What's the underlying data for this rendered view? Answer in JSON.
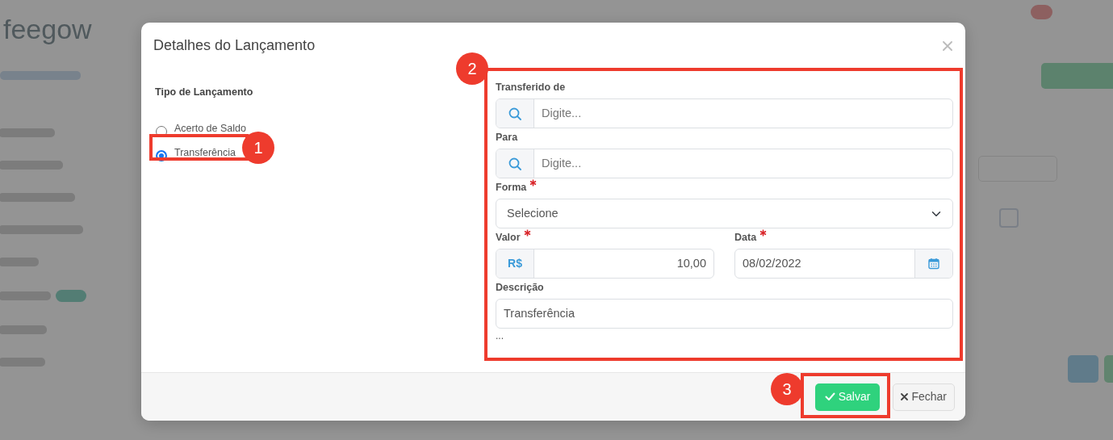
{
  "background": {
    "logo": "feegow",
    "checkbox": {
      "checked": false
    }
  },
  "modal": {
    "title": "Detalhes do Lançamento",
    "type_label": "Tipo de Lançamento",
    "types": [
      {
        "label": "Acerto de Saldo",
        "selected": false
      },
      {
        "label": "Transferência",
        "selected": true
      }
    ],
    "rows": [
      {
        "fields": [
          {
            "kind": "search",
            "label": "Transferido de",
            "required": false,
            "placeholder": "Digite..."
          }
        ]
      },
      {
        "fields": [
          {
            "kind": "search",
            "label": "Para",
            "required": false,
            "placeholder": "Digite..."
          }
        ]
      },
      {
        "fields": [
          {
            "kind": "select",
            "label": "Forma",
            "required": true,
            "value": "Selecione"
          }
        ]
      },
      {
        "fields": [
          {
            "kind": "currency",
            "label": "Valor",
            "required": true,
            "prefix": "R$",
            "value": "10,00"
          },
          {
            "kind": "date",
            "label": "Data",
            "required": true,
            "value": "08/02/2022"
          }
        ]
      },
      {
        "fields": [
          {
            "kind": "text",
            "label": "Descrição",
            "required": false,
            "value": "Transferência"
          }
        ]
      }
    ],
    "more": "...",
    "buttons": [
      {
        "kind": "save",
        "label": "Salvar"
      },
      {
        "kind": "close",
        "label": "Fechar"
      }
    ]
  },
  "annotations": [
    {
      "number": "1"
    },
    {
      "number": "2"
    },
    {
      "number": "3"
    }
  ]
}
